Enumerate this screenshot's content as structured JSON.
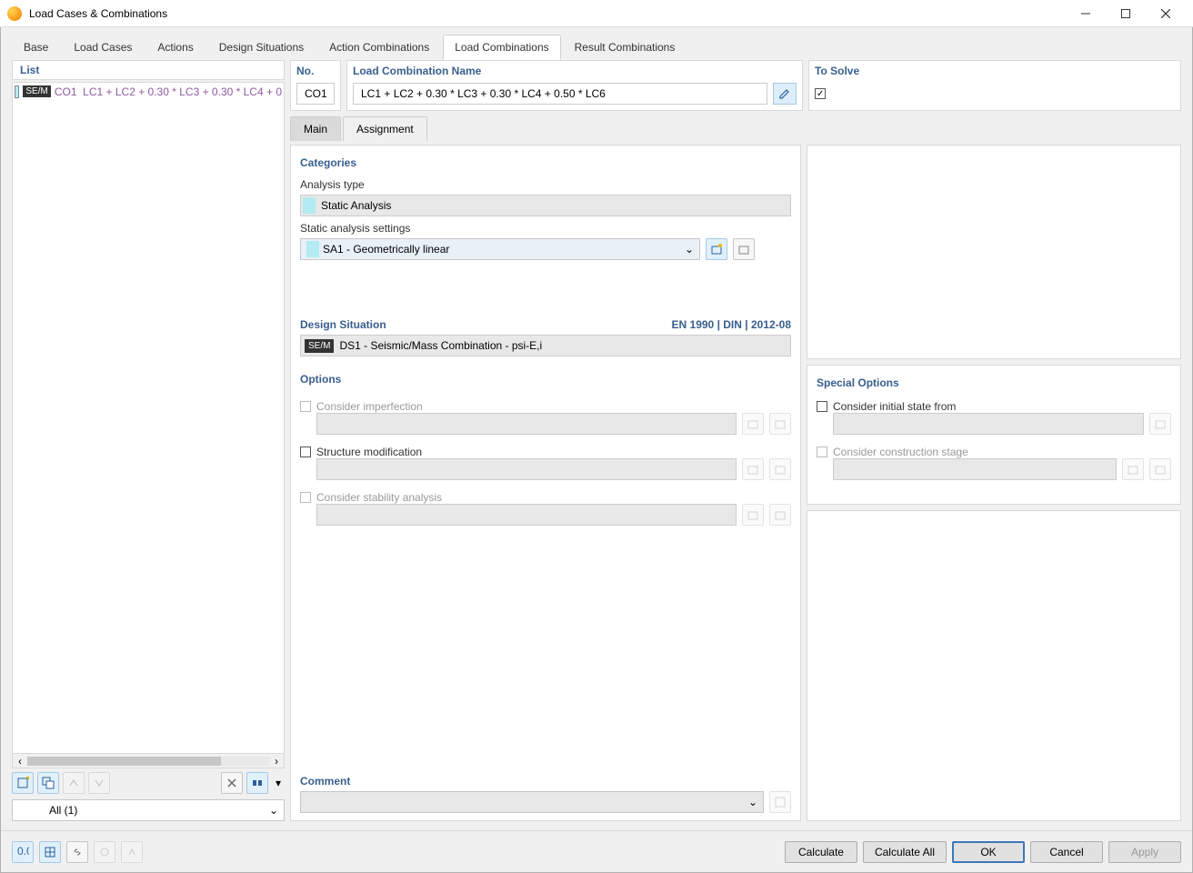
{
  "window": {
    "title": "Load Cases & Combinations"
  },
  "tabs": [
    "Base",
    "Load Cases",
    "Actions",
    "Design Situations",
    "Action Combinations",
    "Load Combinations",
    "Result Combinations"
  ],
  "active_tab": "Load Combinations",
  "list": {
    "header": "List",
    "items": [
      {
        "badge": "SE/M",
        "id": "CO1",
        "name": "LC1 + LC2 + 0.30 * LC3 + 0.30 * LC4 + 0"
      }
    ],
    "filter": "All (1)"
  },
  "detail": {
    "no_header": "No.",
    "no_value": "CO1",
    "name_header": "Load Combination Name",
    "name_value": "LC1 + LC2 + 0.30 * LC3 + 0.30 * LC4 + 0.50 * LC6",
    "to_solve_header": "To Solve",
    "to_solve": true,
    "inner_tabs": [
      "Main",
      "Assignment"
    ],
    "active_inner_tab": "Main",
    "categories": {
      "header": "Categories",
      "analysis_type_label": "Analysis type",
      "analysis_type": "Static Analysis",
      "static_settings_label": "Static analysis settings",
      "static_settings": "SA1 - Geometrically linear"
    },
    "design_situation": {
      "header": "Design Situation",
      "standard": "EN 1990 | DIN | 2012-08",
      "badge": "SE/M",
      "value": "DS1 - Seismic/Mass Combination - psi-E,i"
    },
    "options": {
      "header": "Options",
      "imperfection_label": "Consider imperfection",
      "structure_mod_label": "Structure modification",
      "stability_label": "Consider stability analysis"
    },
    "special_options": {
      "header": "Special Options",
      "initial_state_label": "Consider initial state from",
      "construction_stage_label": "Consider construction stage"
    },
    "comment_header": "Comment",
    "comment_value": ""
  },
  "footer": {
    "calculate": "Calculate",
    "calculate_all": "Calculate All",
    "ok": "OK",
    "cancel": "Cancel",
    "apply": "Apply"
  }
}
